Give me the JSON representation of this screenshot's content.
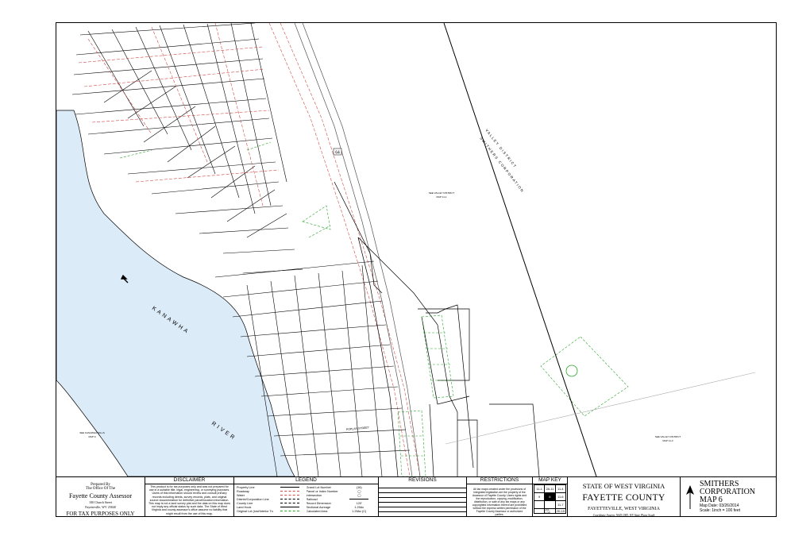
{
  "map": {
    "river_name_1": "KANAWHA",
    "river_name_2": "RIVER",
    "road_label": "64",
    "district_label_1": "SEE VALLEY DISTRICT",
    "district_label_2": "MAP 11-1",
    "district_label_3": "SEE VALLEY DISTRICT",
    "district_label_4": "MAP 11-3",
    "district_label_5": "SEE KANAWHA FALLS",
    "district_label_6": "MAP 9",
    "boundary_label_1": "VALLEY DISTRICT",
    "boundary_label_2": "SMITHERS CORPORATION",
    "street_label_1": "POPLAR STREET",
    "colors": {
      "water": "#dcebf8",
      "parcel_line": "#000000",
      "row_line": "#d04a4a",
      "new_lot": "#2aa52a"
    }
  },
  "prepared": {
    "line1": "Prepared By",
    "line2": "The Office Of The",
    "line3": "Fayette County Assessor",
    "line4a": "100 Church Street",
    "line4b": "Fayetteville, WV 25840",
    "line5": "FOR TAX PURPOSES ONLY"
  },
  "disclaimer": {
    "title": "DISCLAIMER",
    "text": "This product is for tax purposes only and was not prepared for use in a suitable title, legal, engineering, or surveying purposes. Users of this information should review and consult primary records including deeds, survey records, plats, and original source documentation for definitive parcel/location information. This map is not a land survey plat and the data on this map does not imply any official status by such data. The State of West Virginia and county assessor's office assume no liability that might result from the use of this map."
  },
  "legend": {
    "title": "LEGEND",
    "left": [
      "Property Line",
      "Roadway",
      "Water",
      "District/Corporation Line",
      "County Line",
      "Land Hook",
      "Original Lot (lost/Interior Tract)"
    ],
    "right": [
      "Grand Lot Number",
      "Parcel or Index Number",
      "Intersection",
      "Railroad",
      "Record Dimension",
      "Sectional Acreage",
      "Calculated Area"
    ],
    "right_values": [
      "(16)",
      "",
      "",
      "",
      "120'",
      "1.25Ac",
      "1.25Ac (C)"
    ]
  },
  "revisions": {
    "title": "REVISIONS"
  },
  "restrictions": {
    "title": "RESTRICTIONS",
    "text": "All tax maps created under the provisions of integrated legislation are the property of the Assessor of Fayette County. Users rights and the reproduction, copying, modification, distribution, or sale of any tax maps or any copyrighted information thereof are prohibited without the express written permission of the Fayette County Assessor or authorized parties."
  },
  "map_key": {
    "title": "MAP KEY",
    "cells": [
      [
        "11-1",
        "2A-11",
        "11-4"
      ],
      [
        "9",
        "6",
        "11-6"
      ],
      [
        "",
        "",
        "11-7"
      ],
      [
        "",
        "2D-12S",
        "2D-15"
      ]
    ]
  },
  "state_block": {
    "state": "STATE OF WEST VIRGINIA",
    "county": "FAYETTE COUNTY",
    "city": "FAYETTEVILLE, WEST VIRGINIA",
    "note": "Coordinate System: NAD 1983, WV State Plane South"
  },
  "corp": {
    "name1": "SMITHERS",
    "name2": "CORPORATION",
    "map": "MAP  6",
    "date": "Map Date: 03/26/2014",
    "scale": "Scale: 1inch = 100 feet"
  }
}
